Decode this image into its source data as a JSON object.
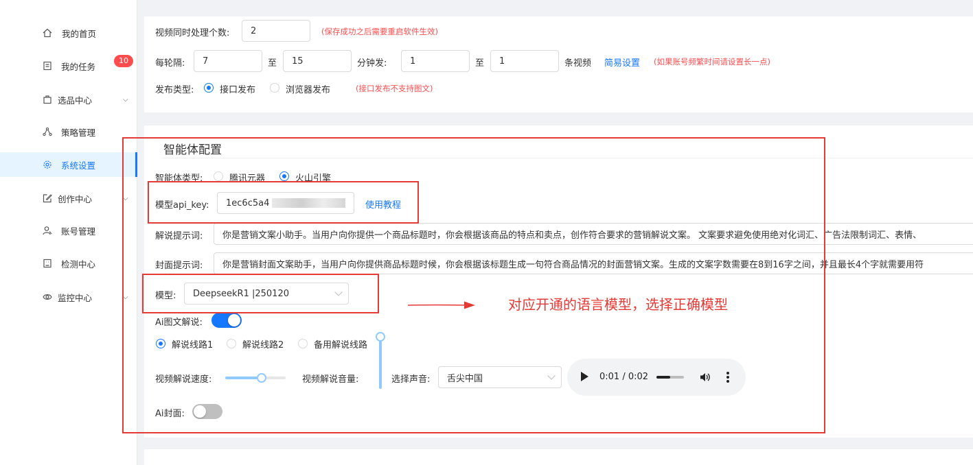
{
  "sidebar": {
    "items": [
      {
        "label": "我的首页",
        "icon": "home-icon"
      },
      {
        "label": "我的任务",
        "icon": "task-icon",
        "badge": "10"
      },
      {
        "label": "选品中心",
        "icon": "bag-icon"
      },
      {
        "label": "策略管理",
        "icon": "strategy-icon"
      },
      {
        "label": "系统设置",
        "icon": "gear-icon"
      },
      {
        "label": "创作中心",
        "icon": "edit-icon"
      },
      {
        "label": "账号管理",
        "icon": "user-icon"
      },
      {
        "label": "检测中心",
        "icon": "monitor-icon"
      },
      {
        "label": "监控中心",
        "icon": "eye-icon"
      }
    ]
  },
  "video_settings": {
    "concurrent_label": "视频同时处理个数:",
    "concurrent_value": "2",
    "concurrent_hint": "(保存成功之后需要重启软件生效)",
    "interval_label": "每轮隔:",
    "interval_from": "7",
    "to_label_1": "至",
    "interval_to": "15",
    "minutes_label": "分钟发:",
    "count_from": "1",
    "to_label_2": "至",
    "count_to": "1",
    "videos_label": "条视频",
    "simple_settings_link": "简易设置",
    "interval_hint": "(如果账号频繁时间请设置长一点)",
    "publish_type_label": "发布类型:",
    "publish_options": [
      "接口发布",
      "浏览器发布"
    ],
    "publish_selected": "接口发布",
    "publish_hint": "(接口发布不支持图文)"
  },
  "agent_config": {
    "title": "智能体配置",
    "agent_type_label": "智能体类型:",
    "agent_types": [
      "腾讯元器",
      "火山引擎"
    ],
    "agent_type_selected": "火山引擎",
    "api_key_label": "模型api_key:",
    "api_key_value": "1ec6c5a4",
    "tutorial_link": "使用教程",
    "narration_prompt_label": "解说提示词:",
    "narration_prompt_value": "你是营销文案小助手。当用户向你提供一个商品标题时，你会根据该商品的特点和卖点，创作符合要求的营销解说文案。 文案要求避免使用绝对化词汇、广告法限制词汇、表情、",
    "cover_prompt_label": "封面提示词:",
    "cover_prompt_value": "你是营销封面文案助手，当用户向你提供商品标题时候，你会根据该标题生成一句符合商品情况的封面营销文案。生成的文案字数需要在8到16字之间，并且最长4个字就需要用符",
    "model_label": "模型:",
    "model_value": "DeepseekR1 |250120",
    "ai_narration_label": "Ai图文解说:",
    "ai_narration_on": true,
    "route_options": [
      "解说线路1",
      "解说线路2",
      "备用解说线路"
    ],
    "route_selected": "解说线路1",
    "speed_label": "视频解说速度:",
    "speed_level": 0.6,
    "volume_label": "视频解说音量:",
    "volume_level": 1.0,
    "voice_label": "选择声音:",
    "voice_value": "舌尖中国",
    "audio_time": "0:01 / 0:02",
    "audio_progress": 0.5,
    "ai_cover_label": "Ai封面:",
    "ai_cover_on": false
  },
  "annotation": {
    "text": "对应开通的语言模型，选择正确模型"
  },
  "colors": {
    "accent": "#1677ff",
    "hint_red": "#ff4d4f",
    "annotation_red": "#e53935"
  }
}
